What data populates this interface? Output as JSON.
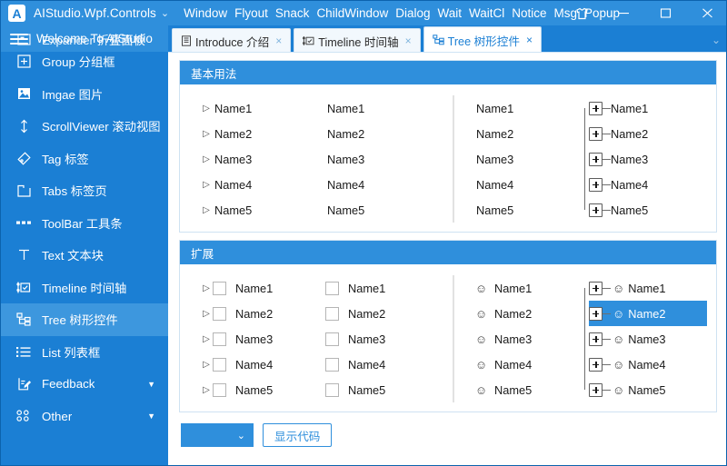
{
  "window": {
    "app_name": "AIStudio.Wpf.Controls",
    "title_chevron": "chevron-down",
    "menu": [
      "Window",
      "Flyout",
      "Snack",
      "ChildWindow",
      "Dialog",
      "Wait",
      "WaitCl",
      "Notice",
      "Msg",
      "Popup"
    ],
    "controls": {
      "theme": "shirt-icon",
      "minimize": "minimize-icon",
      "maximize": "maximize-icon",
      "close": "close-icon"
    },
    "logo_letter": "A",
    "colors": {
      "titlebar": "#2f8fdc",
      "sidebar": "#1b7fd4",
      "accent": "#2f8fdc",
      "selection": "#2f8fdc",
      "sidebar_selected": "#3d97de"
    }
  },
  "sidebar": {
    "header": "Welcome To AIStudio",
    "items": [
      {
        "label": "Expander 折叠面板",
        "icon": "expander-icon",
        "selected": false,
        "clipped": true
      },
      {
        "label": "Group 分组框",
        "icon": "group-icon",
        "selected": false
      },
      {
        "label": "Imgae 图片",
        "icon": "image-icon",
        "selected": false
      },
      {
        "label": "ScrollViewer 滚动视图",
        "icon": "scrollviewer-icon",
        "selected": false
      },
      {
        "label": "Tag 标签",
        "icon": "tag-icon",
        "selected": false
      },
      {
        "label": "Tabs 标签页",
        "icon": "tabs-icon",
        "selected": false
      },
      {
        "label": "ToolBar 工具条",
        "icon": "toolbar-icon",
        "selected": false
      },
      {
        "label": "Text 文本块",
        "icon": "text-icon",
        "selected": false
      },
      {
        "label": "Timeline 时间轴",
        "icon": "timeline-icon",
        "selected": false
      },
      {
        "label": "Tree 树形控件",
        "icon": "tree-icon",
        "selected": true
      },
      {
        "label": "List 列表框",
        "icon": "list-icon",
        "selected": false
      },
      {
        "label": "Feedback",
        "icon": "feedback-icon",
        "selected": false,
        "caret": "▼"
      },
      {
        "label": "Other",
        "icon": "other-icon",
        "selected": false,
        "caret": "▼"
      }
    ]
  },
  "tabs": [
    {
      "label": "Introduce 介绍",
      "icon": "document-icon",
      "close": "×",
      "active": false
    },
    {
      "label": "Timeline 时间轴",
      "icon": "timeline-icon",
      "close": "×",
      "active": false
    },
    {
      "label": "Tree 树形控件",
      "icon": "tree-icon",
      "close": "×",
      "active": true
    }
  ],
  "tabstrip_overflow": "⌄",
  "sections": {
    "basic": {
      "title": "基本用法",
      "col1": {
        "arrow": "▷",
        "items": [
          "Name1",
          "Name2",
          "Name3",
          "Name4",
          "Name5"
        ]
      },
      "col2": {
        "items": [
          "Name1",
          "Name2",
          "Name3",
          "Name4",
          "Name5"
        ]
      },
      "col3": {
        "items": [
          "Name1",
          "Name2",
          "Name3",
          "Name4",
          "Name5"
        ]
      },
      "col4": {
        "expander": "+",
        "items": [
          "Name1",
          "Name2",
          "Name3",
          "Name4",
          "Name5"
        ]
      }
    },
    "extended": {
      "title": "扩展",
      "col1": {
        "arrow": "▷",
        "checkbox": true,
        "items": [
          "Name1",
          "Name2",
          "Name3",
          "Name4",
          "Name5"
        ]
      },
      "col2": {
        "checkbox": true,
        "items": [
          "Name1",
          "Name2",
          "Name3",
          "Name4",
          "Name5"
        ]
      },
      "col3": {
        "smiley": "☺",
        "items": [
          "Name1",
          "Name2",
          "Name3",
          "Name4",
          "Name5"
        ]
      },
      "col4": {
        "expander": "+",
        "smiley": "☺",
        "items": [
          "Name1",
          "Name2",
          "Name3",
          "Name4",
          "Name5"
        ],
        "selected_index": 1
      }
    }
  },
  "footer": {
    "combo_value": "",
    "combo_caret": "⌄",
    "show_code_label": "显示代码"
  }
}
